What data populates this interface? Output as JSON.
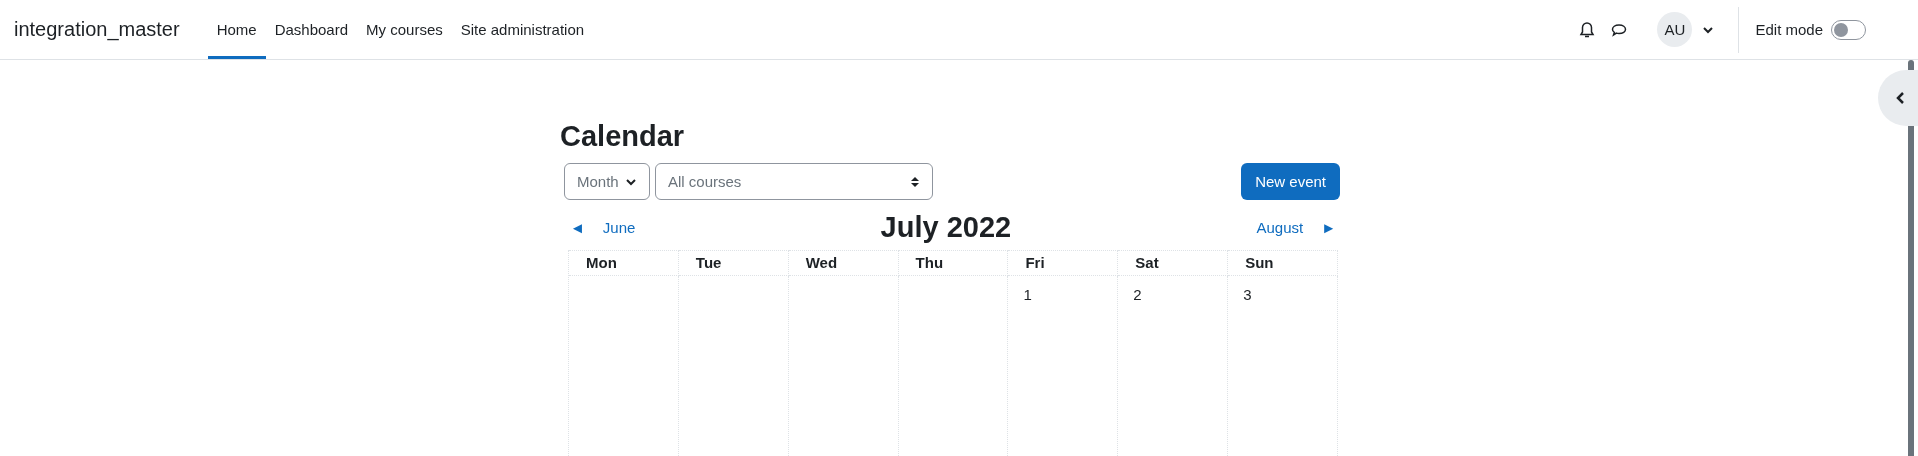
{
  "site_name": "integration_master",
  "nav": [
    {
      "label": "Home",
      "selected": true
    },
    {
      "label": "Dashboard",
      "selected": false
    },
    {
      "label": "My courses",
      "selected": false
    },
    {
      "label": "Site administration",
      "selected": false
    }
  ],
  "user": {
    "initials": "AU"
  },
  "edit_mode": {
    "label": "Edit mode",
    "on": false
  },
  "page_title": "Calendar",
  "view_select": {
    "value": "Month"
  },
  "course_select": {
    "value": "All courses"
  },
  "new_event_button": "New event",
  "prev_month": {
    "arrow": "◄",
    "label": "June"
  },
  "month_title": "July 2022",
  "next_month": {
    "label": "August",
    "arrow": "►"
  },
  "weekdays": [
    "Mon",
    "Tue",
    "Wed",
    "Thu",
    "Fri",
    "Sat",
    "Sun"
  ],
  "weeks": [
    {
      "cells": [
        {},
        {},
        {},
        {},
        {
          "day": "1"
        },
        {
          "day": "2"
        },
        {
          "day": "3"
        }
      ]
    }
  ]
}
